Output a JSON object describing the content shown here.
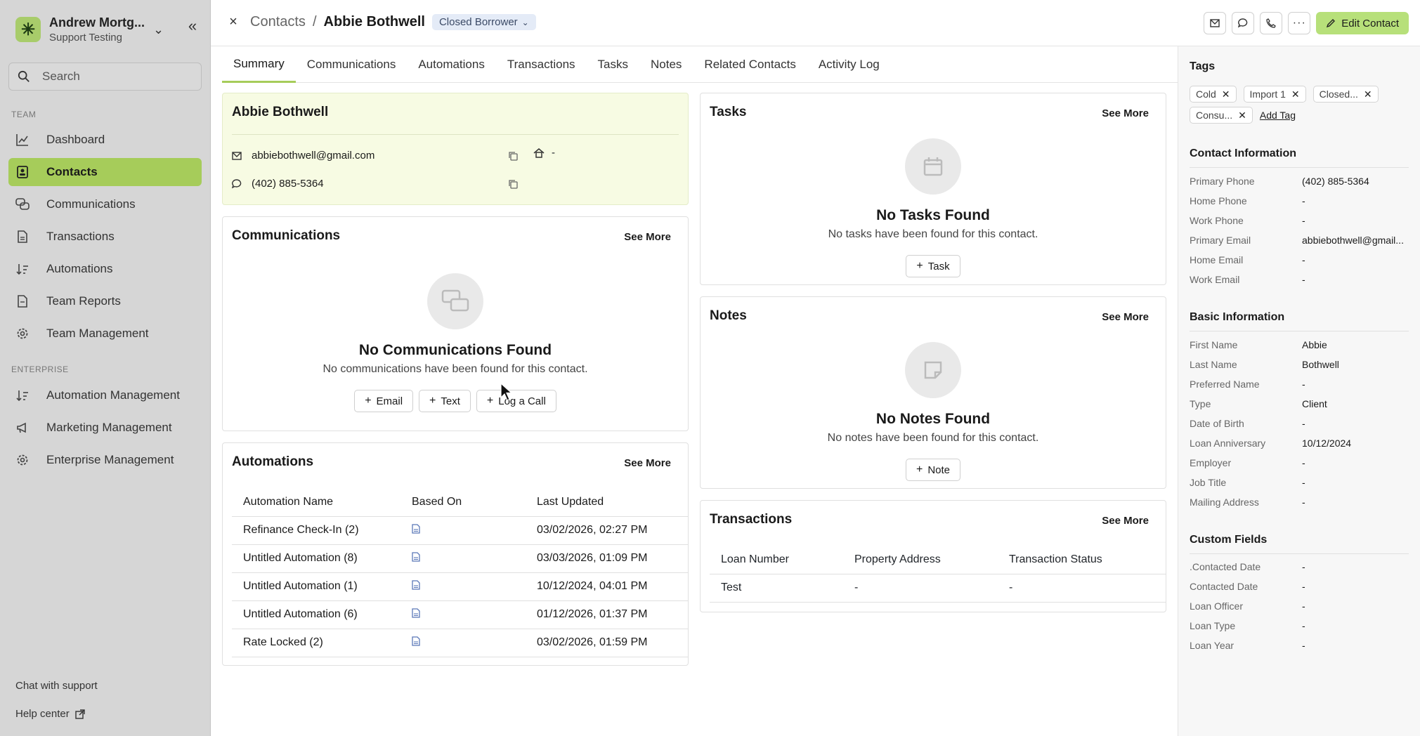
{
  "sidebar": {
    "org_name": "Andrew Mortg...",
    "org_sub": "Support Testing",
    "search_placeholder": "Search",
    "team_label": "TEAM",
    "enterprise_label": "ENTERPRISE",
    "team_items": [
      {
        "label": "Dashboard",
        "icon": "chart-line-icon"
      },
      {
        "label": "Contacts",
        "icon": "contact-book-icon"
      },
      {
        "label": "Communications",
        "icon": "chat-bubbles-icon"
      },
      {
        "label": "Transactions",
        "icon": "document-icon"
      },
      {
        "label": "Automations",
        "icon": "sort-automation-icon"
      },
      {
        "label": "Team Reports",
        "icon": "report-icon"
      },
      {
        "label": "Team Management",
        "icon": "gear-icon"
      }
    ],
    "enterprise_items": [
      {
        "label": "Automation Management",
        "icon": "sort-automation-icon"
      },
      {
        "label": "Marketing Management",
        "icon": "megaphone-icon"
      },
      {
        "label": "Enterprise Management",
        "icon": "gear-icon"
      }
    ],
    "chat_support": "Chat with support",
    "help_center": "Help center"
  },
  "header": {
    "breadcrumb_root": "Contacts",
    "breadcrumb_sep": "/",
    "contact_name": "Abbie Bothwell",
    "status": "Closed Borrower",
    "edit_label": "Edit Contact"
  },
  "tabs": [
    "Summary",
    "Communications",
    "Automations",
    "Transactions",
    "Tasks",
    "Notes",
    "Related Contacts",
    "Activity Log"
  ],
  "contact": {
    "name": "Abbie Bothwell",
    "email": "abbiebothwell@gmail.com",
    "phone": "(402) 885-5364",
    "home": "-"
  },
  "communications": {
    "title": "Communications",
    "see_more": "See More",
    "empty_title": "No Communications Found",
    "empty_sub": "No communications have been found for this contact.",
    "buttons": [
      "Email",
      "Text",
      "Log a Call"
    ]
  },
  "automations": {
    "title": "Automations",
    "see_more": "See More",
    "columns": [
      "Automation Name",
      "Based On",
      "Last Updated"
    ],
    "rows": [
      {
        "name": "Refinance Check-In (2)",
        "updated": "03/02/2026, 02:27 PM"
      },
      {
        "name": "Untitled Automation (8)",
        "updated": "03/03/2026, 01:09 PM"
      },
      {
        "name": "Untitled Automation (1)",
        "updated": "10/12/2024, 04:01 PM"
      },
      {
        "name": "Untitled Automation (6)",
        "updated": "01/12/2026, 01:37 PM"
      },
      {
        "name": "Rate Locked (2)",
        "updated": "03/02/2026, 01:59 PM"
      }
    ]
  },
  "tasks": {
    "title": "Tasks",
    "see_more": "See More",
    "empty_title": "No Tasks Found",
    "empty_sub": "No tasks have been found for this contact.",
    "button": "Task"
  },
  "notes": {
    "title": "Notes",
    "see_more": "See More",
    "empty_title": "No Notes Found",
    "empty_sub": "No notes have been found for this contact.",
    "button": "Note"
  },
  "transactions": {
    "title": "Transactions",
    "see_more": "See More",
    "columns": [
      "Loan Number",
      "Property Address",
      "Transaction Status"
    ],
    "rows": [
      {
        "loan": "Test",
        "address": "-",
        "status": "-"
      }
    ]
  },
  "right_panel": {
    "tags_title": "Tags",
    "tags": [
      "Cold",
      "Import 1",
      "Closed...",
      "Consu..."
    ],
    "add_tag": "Add Tag",
    "contact_info_title": "Contact Information",
    "contact_info": [
      {
        "k": "Primary Phone",
        "v": "(402) 885-5364"
      },
      {
        "k": "Home Phone",
        "v": "-"
      },
      {
        "k": "Work Phone",
        "v": "-"
      },
      {
        "k": "Primary Email",
        "v": "abbiebothwell@gmail..."
      },
      {
        "k": "Home Email",
        "v": "-"
      },
      {
        "k": "Work Email",
        "v": "-"
      }
    ],
    "basic_info_title": "Basic Information",
    "basic_info": [
      {
        "k": "First Name",
        "v": "Abbie"
      },
      {
        "k": "Last Name",
        "v": "Bothwell"
      },
      {
        "k": "Preferred Name",
        "v": "-"
      },
      {
        "k": "Type",
        "v": "Client"
      },
      {
        "k": "Date of Birth",
        "v": "-"
      },
      {
        "k": "Loan Anniversary",
        "v": "10/12/2024"
      },
      {
        "k": "Employer",
        "v": "-"
      },
      {
        "k": "Job Title",
        "v": "-"
      },
      {
        "k": "Mailing Address",
        "v": "-"
      }
    ],
    "custom_title": "Custom Fields",
    "custom": [
      {
        "k": ".Contacted Date",
        "v": "-"
      },
      {
        "k": "Contacted Date",
        "v": "-"
      },
      {
        "k": "Loan Officer",
        "v": "-"
      },
      {
        "k": "Loan Type",
        "v": "-"
      },
      {
        "k": "Loan Year",
        "v": "-"
      }
    ]
  },
  "colors": {
    "accent": "#a6cc5a",
    "edit_button": "#b7e07a",
    "contact_card_bg": "#f7fbe3",
    "status_pill_bg": "#e4ebf7"
  }
}
